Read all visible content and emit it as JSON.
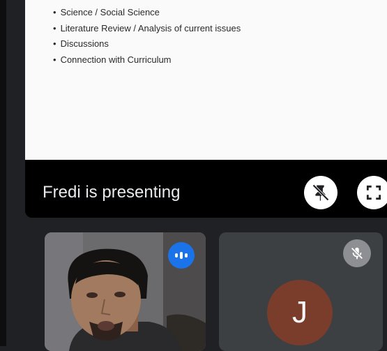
{
  "slide": {
    "bullets": [
      "Science / Social Science",
      "Literature Review / Analysis of current issues",
      "Discussions",
      "Connection with Curriculum"
    ]
  },
  "presentation": {
    "status_text": "Fredi is presenting",
    "unpin_icon": "unpin-icon",
    "fullscreen_icon": "fullscreen-icon"
  },
  "participants": [
    {
      "type": "video",
      "indicator_icon": "speaking-indicator-icon"
    },
    {
      "type": "avatar",
      "initial": "J",
      "indicator_icon": "mic-off-icon"
    }
  ],
  "colors": {
    "background": "#202124",
    "tile_background": "#3c4043",
    "speaking_indicator": "#1a73e8",
    "avatar": "#7a3d2b"
  }
}
